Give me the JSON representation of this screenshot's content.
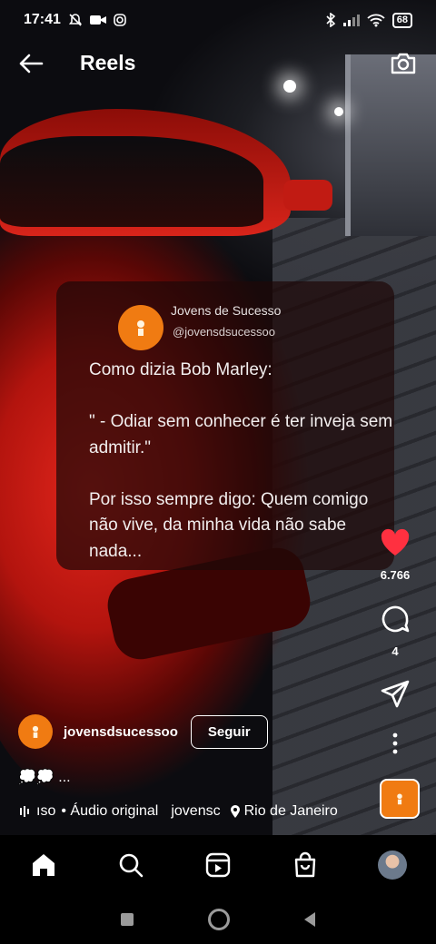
{
  "status_bar": {
    "time": "17:41",
    "battery": "68"
  },
  "header": {
    "title": "Reels"
  },
  "quote_card": {
    "name": "Jovens de Sucesso",
    "handle": "@jovensdsucessoo",
    "text": "Como dizia Bob Marley:\n\n\" - Odiar sem conhecer é ter inveja sem admitir.\"\n\nPor isso sempre digo: Quem comigo não vive, da minha vida não sabe nada..."
  },
  "actions": {
    "likes": "6.766",
    "comments": "4"
  },
  "author": {
    "username": "jovensdsucessoo",
    "follow_label": "Seguir"
  },
  "caption": "💭💭 ...",
  "audio": {
    "artist_fragment": "ıso",
    "label": "• Áudio original",
    "user": "jovensc",
    "location": "Rio de Janeiro"
  },
  "colors": {
    "like": "#ff3040",
    "brand_orange": "#f07b12"
  },
  "icons": [
    "back-arrow-icon",
    "camera-icon",
    "heart-icon",
    "comment-icon",
    "share-icon",
    "more-icon",
    "home-icon",
    "search-icon",
    "reels-icon",
    "shop-icon"
  ]
}
